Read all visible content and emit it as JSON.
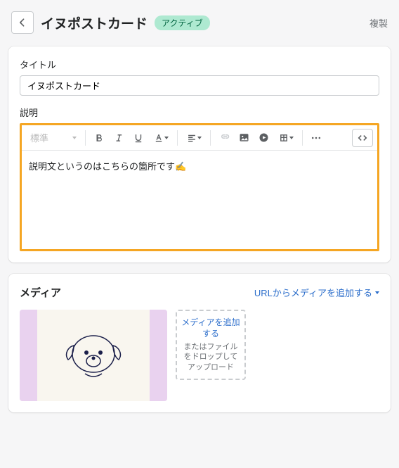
{
  "header": {
    "title": "イヌポストカード",
    "status": "アクティブ",
    "action": "複製"
  },
  "form": {
    "title_label": "タイトル",
    "title_value": "イヌポストカード",
    "desc_label": "説明",
    "para_style": "標準",
    "desc_value": "説明文というのはこちらの箇所です✍️"
  },
  "media": {
    "heading": "メディア",
    "add_url": "URLからメディアを追加する",
    "dropzone_link": "メディアを追加する",
    "dropzone_hint": "またはファイルをドロップしてアップロード"
  }
}
